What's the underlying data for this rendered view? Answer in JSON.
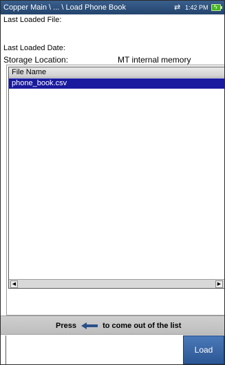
{
  "titlebar": {
    "breadcrumb": "Copper Main \\ ... \\ Load Phone Book",
    "time": "1:42 PM",
    "sync_icon": "sync-arrows-icon",
    "battery_icon": "battery-charging-icon"
  },
  "info": {
    "last_loaded_file_label": "Last Loaded File:",
    "last_loaded_date_label": "Last Loaded Date:",
    "storage_location_label": "Storage Location:",
    "storage_location_value": "MT internal memory"
  },
  "filelist": {
    "column_header": "File Name",
    "rows": [
      {
        "name": "phone_book.csv",
        "selected": true
      }
    ]
  },
  "hint": {
    "prefix": "Press",
    "suffix": "to come out of the list",
    "icon": "back-arrow-icon"
  },
  "actions": {
    "load_label": "Load"
  },
  "colors": {
    "titlebar": "#2e5280",
    "selection": "#1a1a9e",
    "load_button": "#3a67a6"
  }
}
